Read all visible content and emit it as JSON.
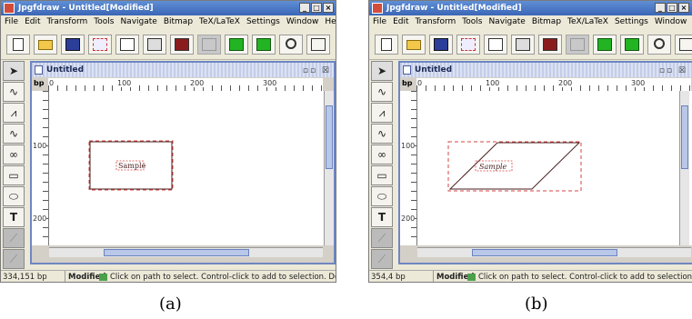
{
  "window": {
    "title": "Jpgfdraw - Untitled[Modified]",
    "buttons": [
      "_",
      "□",
      "×"
    ]
  },
  "menu": [
    "File",
    "Edit",
    "Transform",
    "Tools",
    "Navigate",
    "Bitmap",
    "TeX/LaTeX",
    "Settings",
    "Window",
    "Help"
  ],
  "toolbar": [
    {
      "name": "new-icon"
    },
    {
      "name": "open-folder-icon"
    },
    {
      "name": "save-disk-icon"
    },
    {
      "name": "select-region-icon"
    },
    {
      "name": "export-icon"
    },
    {
      "name": "print-icon"
    },
    {
      "name": "book-icon"
    },
    {
      "name": "grid-icon"
    },
    {
      "name": "green-layer-icon"
    },
    {
      "name": "green-layer-2-icon"
    },
    {
      "name": "redo-icon"
    },
    {
      "name": "frame-icon"
    }
  ],
  "tools": [
    "pointer",
    "open-line",
    "closed-line",
    "curve",
    "loop",
    "rectangle",
    "ellipse",
    "T",
    "disabled",
    "disabled-2"
  ],
  "document": {
    "title": "Untitled",
    "unit_label": "bp",
    "ruler_top": [
      "0",
      "100",
      "200",
      "300"
    ],
    "ruler_left": [
      "100",
      "200"
    ],
    "shape_text": "Sample"
  },
  "panels": [
    {
      "id": "a",
      "status_coord": "334,151 bp",
      "status_modified": "Modified",
      "status_hint": "Click on path to select. Control-click to add to selection. Doub",
      "caption": "(a)"
    },
    {
      "id": "b",
      "status_coord": "354,4 bp",
      "status_modified": "Modified",
      "status_hint": "Click on path to select. Control-click to add to selection. Dou",
      "caption": "(b)"
    }
  ],
  "colors": {
    "selection": "#d64545",
    "shape": "#4a1f1f",
    "inner_border": "#6f86c2",
    "title_bar": "#3b66b6"
  }
}
